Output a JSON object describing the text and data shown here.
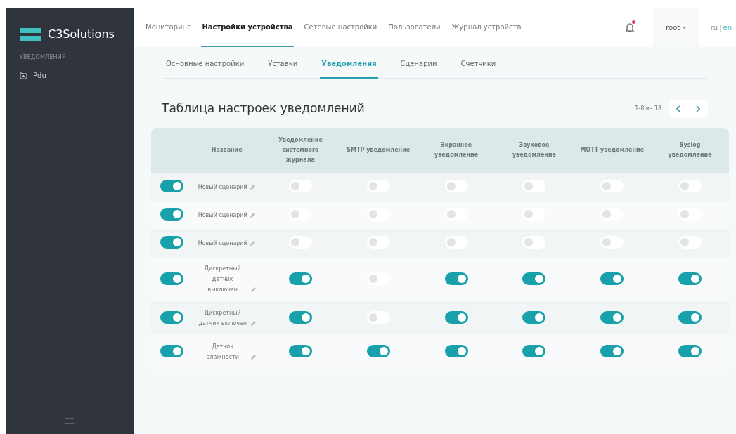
{
  "sidebar": {
    "logo": "C3Solutions",
    "section": "УВЕДОМЛЕНИЯ",
    "items": [
      {
        "label": "Pdu",
        "selected": false
      }
    ]
  },
  "top_nav": {
    "items": [
      {
        "label": "Мониторинг",
        "selected": false
      },
      {
        "label": "Настройки устройства",
        "selected": true
      },
      {
        "label": "Сетевые настройки",
        "selected": false
      },
      {
        "label": "Пользователи",
        "selected": false
      },
      {
        "label": "Журнал устройств",
        "selected": false
      }
    ],
    "notifications": true,
    "user": "root",
    "lang": [
      {
        "label": "ru",
        "selected": false
      },
      {
        "label": "en",
        "selected": true
      }
    ],
    "lang_separator": "|"
  },
  "tabs": [
    {
      "label": "Основные настройки",
      "selected": false
    },
    {
      "label": "Уставки",
      "selected": false
    },
    {
      "label": "Уведомления",
      "selected": true
    },
    {
      "label": "Сценарии",
      "selected": false
    },
    {
      "label": "Счетчики",
      "selected": false
    }
  ],
  "table": {
    "title": "Таблица настроек уведомлений",
    "pagination": "1-8 из 18",
    "columns": [
      "Название",
      "Уведомление системного журнала",
      "SMTP уведомление",
      "Экранное уведомление",
      "Звуковое уведомление",
      "MQTT уведомление",
      "Syslog уведомление"
    ],
    "rows": [
      {
        "enabled": true,
        "name": "Новый сценарий",
        "toggles": [
          false,
          false,
          false,
          false,
          false,
          false
        ]
      },
      {
        "enabled": true,
        "name": "Новый сценарий",
        "toggles": [
          false,
          false,
          false,
          false,
          false,
          false
        ]
      },
      {
        "enabled": true,
        "name": "Новый сценарий",
        "toggles": [
          false,
          false,
          false,
          false,
          false,
          false
        ]
      },
      {
        "enabled": true,
        "name": "Дискретный датчик выключен",
        "toggles": [
          true,
          false,
          true,
          true,
          true,
          true
        ]
      },
      {
        "enabled": true,
        "name": "Дискретный датчик включен",
        "toggles": [
          true,
          false,
          true,
          true,
          true,
          true
        ]
      },
      {
        "enabled": true,
        "name": "Датчик влажности",
        "toggles": [
          true,
          true,
          true,
          true,
          true,
          true
        ]
      }
    ]
  }
}
